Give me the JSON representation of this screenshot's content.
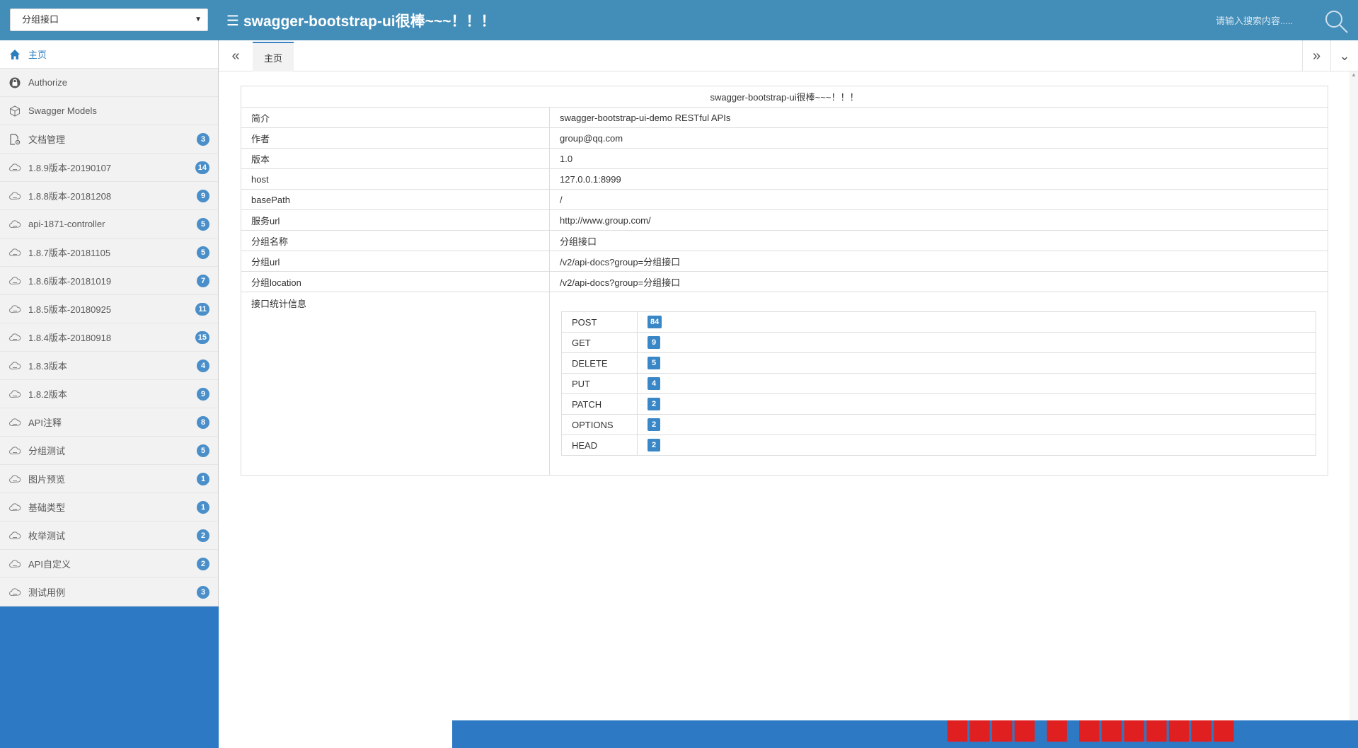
{
  "header": {
    "group_select_value": "分组接口",
    "title": "swagger-bootstrap-ui很棒~~~！！！",
    "search_placeholder": "请输入搜索内容....."
  },
  "sidebar": {
    "items": [
      {
        "label": "主页",
        "icon": "home-icon",
        "badge": ""
      },
      {
        "label": "Authorize",
        "icon": "lock-icon",
        "badge": ""
      },
      {
        "label": "Swagger Models",
        "icon": "cube-icon",
        "badge": ""
      },
      {
        "label": "文档管理",
        "icon": "document-gear-icon",
        "badge": "3"
      },
      {
        "label": "1.8.9版本-20190107",
        "icon": "cloud-icon",
        "badge": "14"
      },
      {
        "label": "1.8.8版本-20181208",
        "icon": "cloud-icon",
        "badge": "9"
      },
      {
        "label": "api-1871-controller",
        "icon": "cloud-icon",
        "badge": "5"
      },
      {
        "label": "1.8.7版本-20181105",
        "icon": "cloud-icon",
        "badge": "5"
      },
      {
        "label": "1.8.6版本-20181019",
        "icon": "cloud-icon",
        "badge": "7"
      },
      {
        "label": "1.8.5版本-20180925",
        "icon": "cloud-icon",
        "badge": "11"
      },
      {
        "label": "1.8.4版本-20180918",
        "icon": "cloud-icon",
        "badge": "15"
      },
      {
        "label": "1.8.3版本",
        "icon": "cloud-icon",
        "badge": "4"
      },
      {
        "label": "1.8.2版本",
        "icon": "cloud-icon",
        "badge": "9"
      },
      {
        "label": "API注释",
        "icon": "cloud-icon",
        "badge": "8"
      },
      {
        "label": "分组测试",
        "icon": "cloud-icon",
        "badge": "5"
      },
      {
        "label": "图片预览",
        "icon": "cloud-icon",
        "badge": "1"
      },
      {
        "label": "基础类型",
        "icon": "cloud-icon",
        "badge": "1"
      },
      {
        "label": "枚举测试",
        "icon": "cloud-icon",
        "badge": "2"
      },
      {
        "label": "API自定义",
        "icon": "cloud-icon",
        "badge": "2"
      },
      {
        "label": "测试用例",
        "icon": "cloud-icon",
        "badge": "3"
      }
    ]
  },
  "tabs": {
    "home_label": "主页"
  },
  "info": {
    "title": "swagger-bootstrap-ui很棒~~~！！！",
    "rows": [
      {
        "key": "简介",
        "value": "swagger-bootstrap-ui-demo RESTful APIs"
      },
      {
        "key": "作者",
        "value": "group@qq.com"
      },
      {
        "key": "版本",
        "value": "1.0"
      },
      {
        "key": "host",
        "value": "127.0.0.1:8999"
      },
      {
        "key": "basePath",
        "value": "/"
      },
      {
        "key": "服务url",
        "value": "http://www.group.com/"
      },
      {
        "key": "分组名称",
        "value": "分组接口"
      },
      {
        "key": "分组url",
        "value": "/v2/api-docs?group=分组接口"
      },
      {
        "key": "分组location",
        "value": "/v2/api-docs?group=分组接口"
      }
    ],
    "stats_label": "接口统计信息",
    "stats": [
      {
        "method": "POST",
        "count": "84"
      },
      {
        "method": "GET",
        "count": "9"
      },
      {
        "method": "DELETE",
        "count": "5"
      },
      {
        "method": "PUT",
        "count": "4"
      },
      {
        "method": "PATCH",
        "count": "2"
      },
      {
        "method": "OPTIONS",
        "count": "2"
      },
      {
        "method": "HEAD",
        "count": "2"
      }
    ]
  },
  "colors": {
    "header_bg": "#438eb9",
    "sidebar_bg": "#2d79c4",
    "badge_bg": "#4a8fc9",
    "active_link": "#2b7dbc"
  }
}
